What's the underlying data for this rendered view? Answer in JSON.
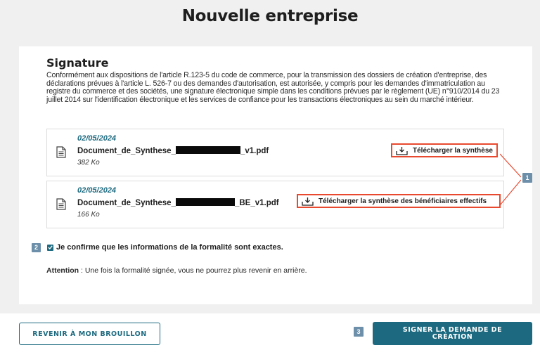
{
  "header": {
    "title": "Nouvelle entreprise"
  },
  "signature": {
    "heading": "Signature",
    "legal_text": "Conformément aux dispositions de l'article R.123-5 du code de commerce, pour la transmission des dossiers de création d'entreprise, des déclarations prévues à l'article L. 526-7 ou des demandes d'autorisation, est autorisée, y compris pour les demandes d'immatriculation au registre du commerce et des sociétés, une signature électronique simple dans les conditions prévues par le règlement (UE) n°910/2014 du 23 juillet 2014 sur l'identification électronique et les services de confiance pour les transactions électroniques au sein du marché intérieur."
  },
  "documents": [
    {
      "date": "02/05/2024",
      "name_prefix": "Document_de_Synthese_",
      "name_suffix": "_v1.pdf",
      "size": "382 Ko",
      "download_label": "Télécharger la synthèse"
    },
    {
      "date": "02/05/2024",
      "name_prefix": "Document_de_Synthese_",
      "name_suffix": "_BE_v1.pdf",
      "size": "166 Ko",
      "download_label": "Télécharger la synthèse des bénéficiaires effectifs"
    }
  ],
  "badges": {
    "one": "1",
    "two": "2",
    "three": "3"
  },
  "confirm": {
    "label": "Je confirme que les informations de la formalité sont exactes.",
    "checked": true
  },
  "attention": {
    "label": "Attention",
    "text": " : Une fois la formalité signée, vous ne pourrez plus revenir en arrière."
  },
  "footer": {
    "draft_button": "REVENIR À MON BROUILLON",
    "sign_button": "SIGNER LA DEMANDE DE CRÉATION"
  },
  "colors": {
    "accent": "#1d6a80",
    "highlight": "#e8492f",
    "badge": "#6d8fa9"
  }
}
